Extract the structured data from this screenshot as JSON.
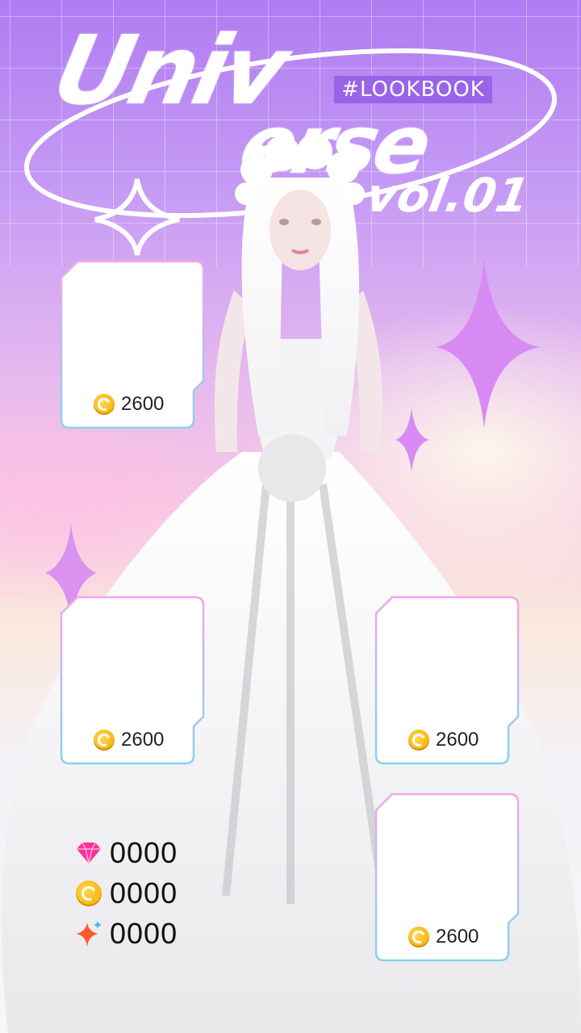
{
  "header": {
    "title_line1": "Univ",
    "title_line2": "erse",
    "tag": "#LOOKBOOK",
    "volume": "vol.01"
  },
  "cards": [
    {
      "id": "card-1",
      "price": "2600",
      "price_icon": "coin-icon"
    },
    {
      "id": "card-2",
      "price": "2600",
      "price_icon": "coin-icon"
    },
    {
      "id": "card-3",
      "price": "2600",
      "price_icon": "coin-icon"
    },
    {
      "id": "card-4",
      "price": "2600",
      "price_icon": "coin-icon"
    }
  ],
  "currency": [
    {
      "icon": "diamond-icon",
      "value": "0000"
    },
    {
      "icon": "coin-icon",
      "value": "0000"
    },
    {
      "icon": "sparkle-icon",
      "value": "0000"
    }
  ],
  "colors": {
    "accent_purple": "#b07cf2",
    "card_border_pink": "#f0a6ec",
    "card_border_blue": "#86d3f2",
    "coin_gold": "#f6b800",
    "diamond_pink": "#ff2f9a",
    "sparkle_orange": "#ff5a2a"
  }
}
